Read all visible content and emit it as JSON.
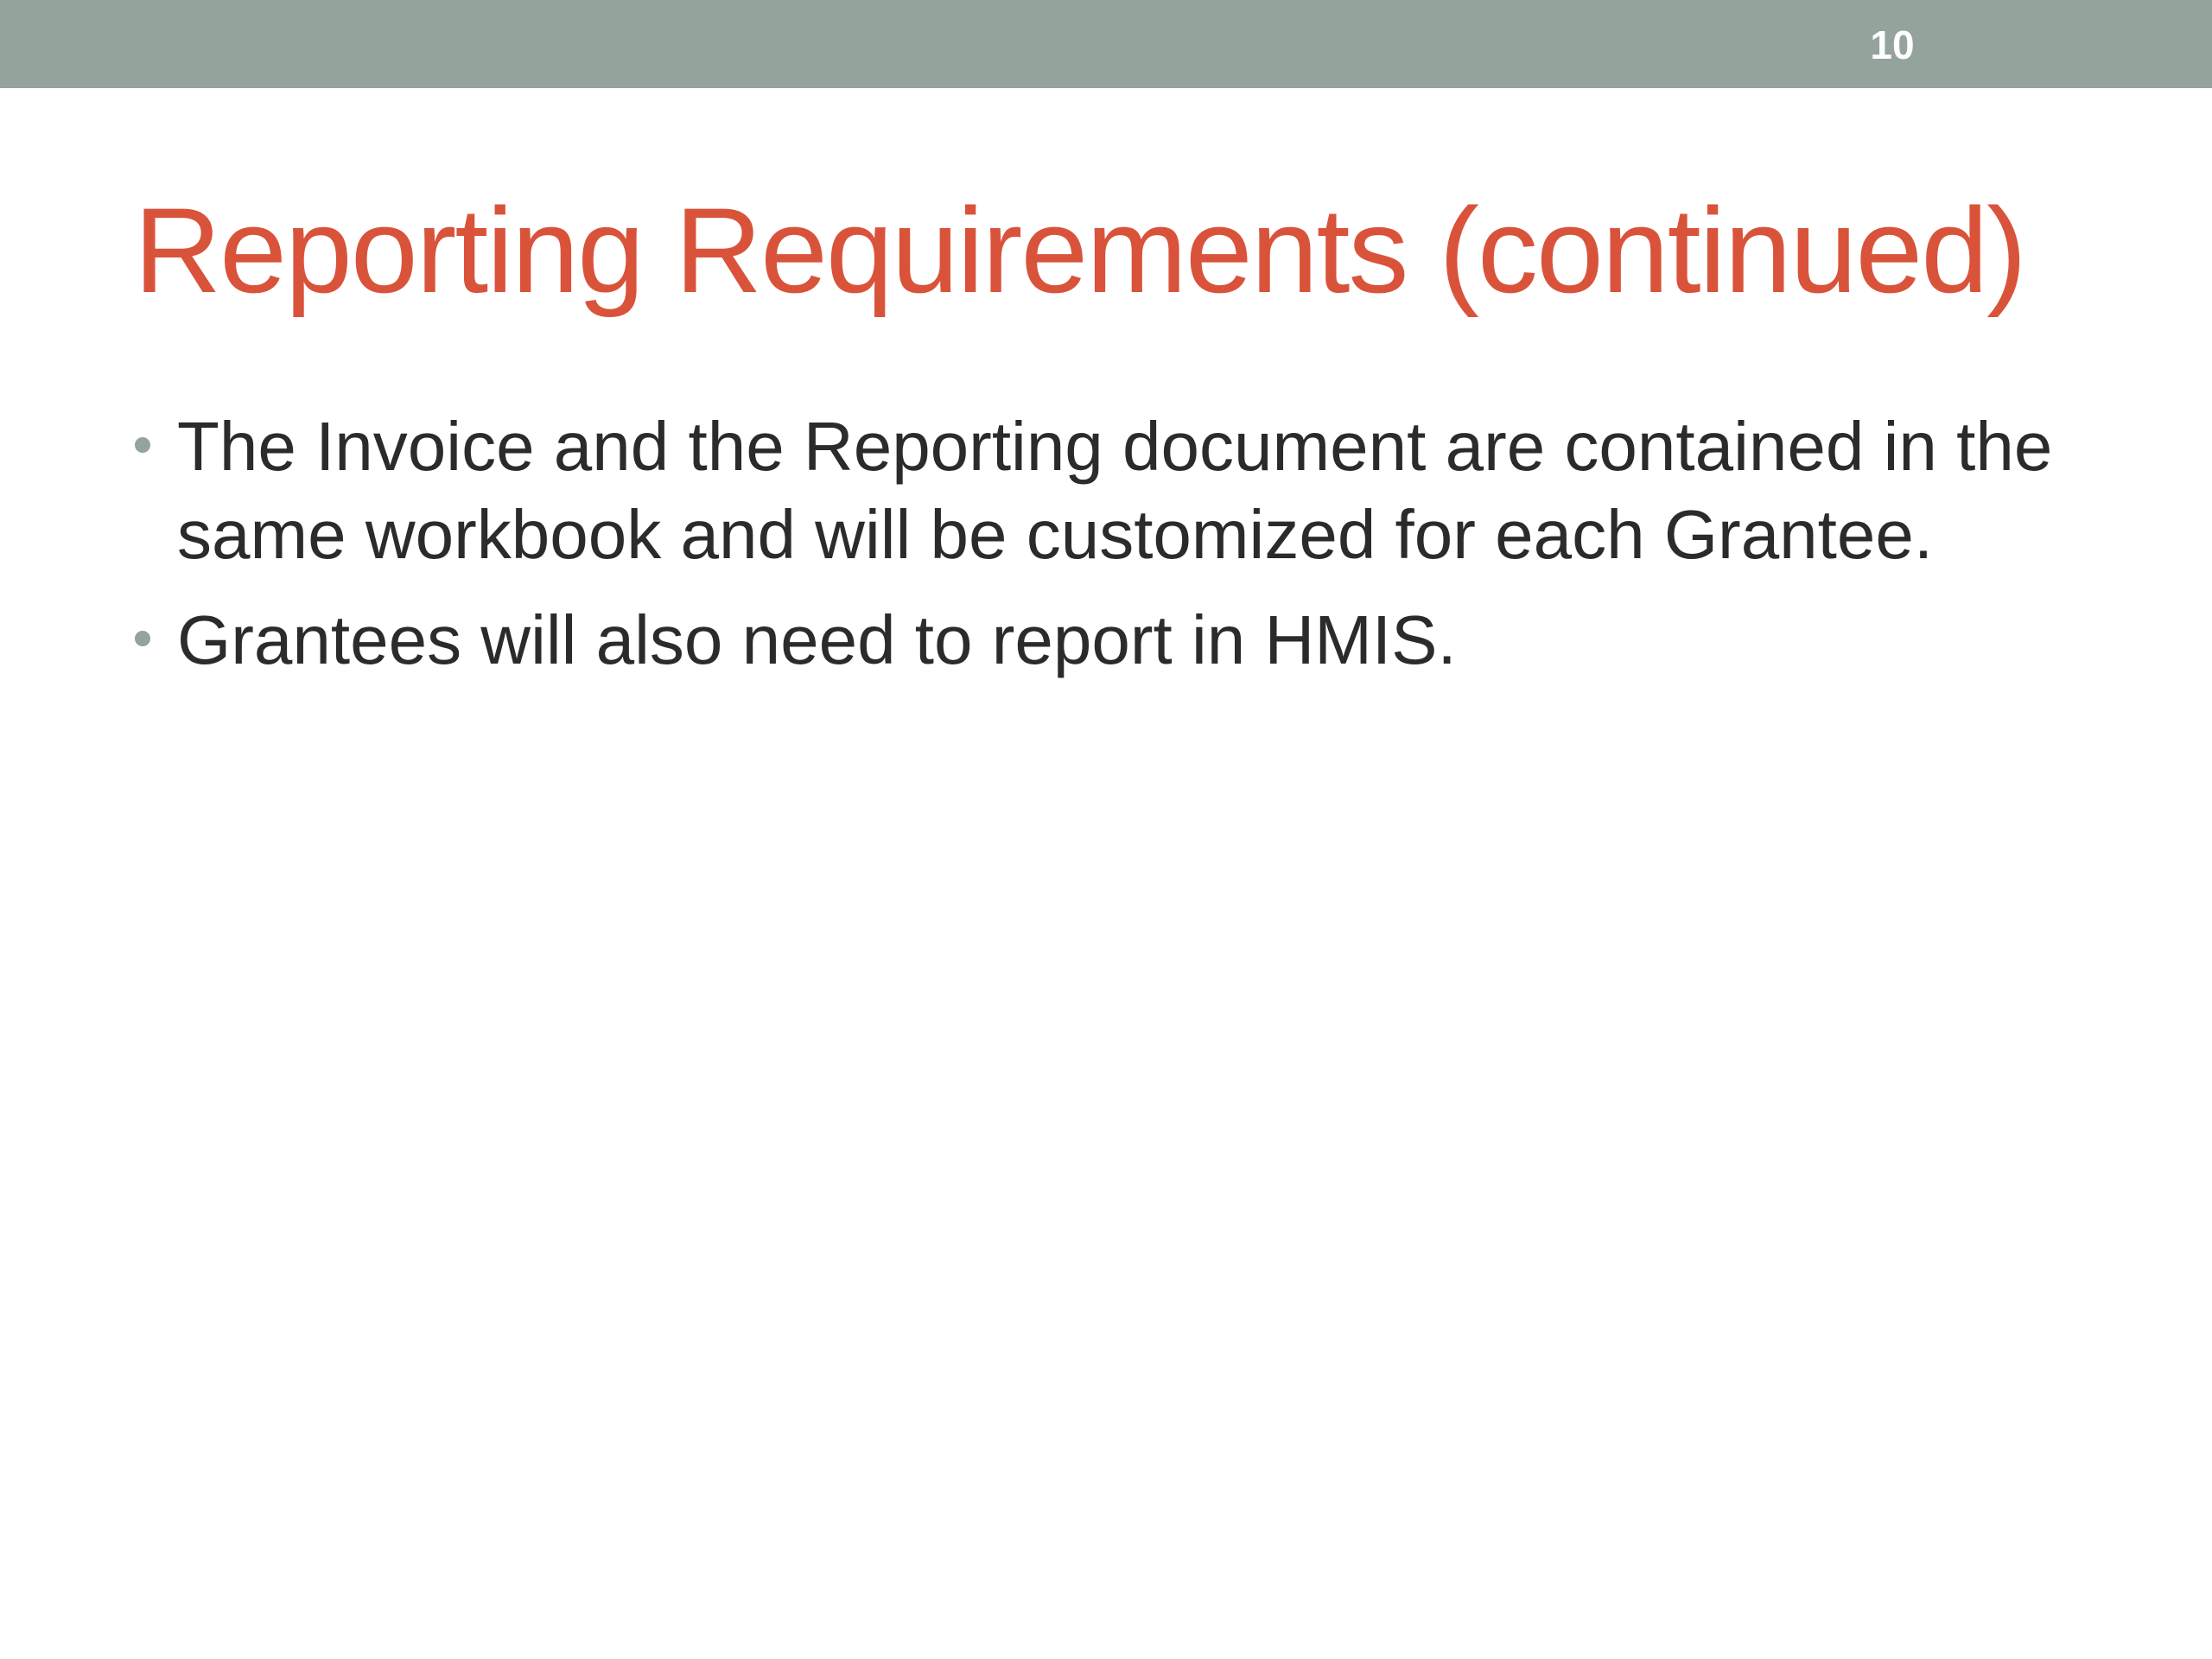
{
  "slide_number": "10",
  "title": "Reporting Requirements (continued)",
  "bullets": [
    "The Invoice and the Reporting document are contained in the same workbook and will be customized for each Grantee.",
    "Grantees will also need to report in HMIS."
  ],
  "colors": {
    "header_bar": "#94a39c",
    "title": "#d9533b",
    "body_text": "#2b2b2b",
    "bullet": "#94a39c",
    "background": "#ffffff"
  }
}
